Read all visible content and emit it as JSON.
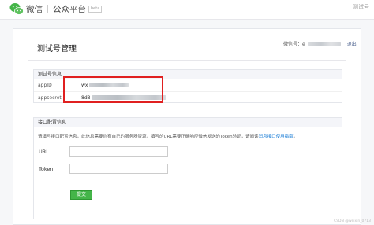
{
  "header": {
    "logo_icon": "wechat-logo-icon",
    "app_name": "微信",
    "platform_name": "公众平台",
    "beta_badge": "beta",
    "right_text": "测试号"
  },
  "page": {
    "title": "测试号管理",
    "wechat_id_label": "微信号：",
    "wechat_id_prefix": "e",
    "logout_label": "退出"
  },
  "test_account_info": {
    "title": "测试号信息",
    "rows": [
      {
        "label": "appID",
        "value_prefix": "wx"
      },
      {
        "label": "appsecret",
        "value_prefix": "8d8"
      }
    ],
    "highlight_color": "#e02020"
  },
  "interface_config": {
    "title": "接口配置信息",
    "description": "请填写接口配置信息，此信息需要你有自己的服务器资源，填写的URL需要正确响应微信发送的Token验证，请阅读",
    "description_link": "消息接口使用指南",
    "description_end": "。",
    "url_label": "URL",
    "url_value": "",
    "token_label": "Token",
    "token_value": "",
    "submit_label": "提交",
    "submit_color": "#44b549"
  },
  "watermark": "CSDN @weixin_0713"
}
